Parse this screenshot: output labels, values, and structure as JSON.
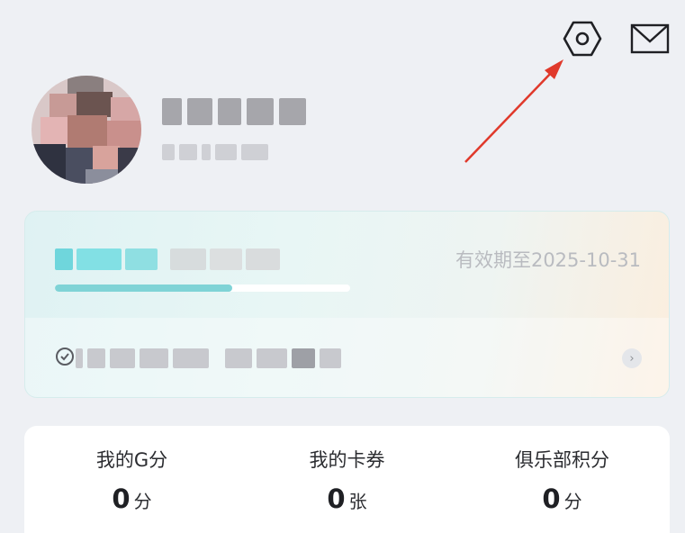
{
  "header": {
    "settings_icon": "settings-hexagon-icon",
    "mail_icon": "mail-icon",
    "annotation_color": "#e0392b"
  },
  "profile": {
    "avatar": "avatar-pixelated",
    "name_redacted": true,
    "id_redacted": true
  },
  "membership": {
    "validity_text": "有效期至2025-10-31",
    "progress_fraction": 0.6,
    "benefit_icon": "coupon-circle-icon",
    "chevron": "›"
  },
  "stats": [
    {
      "label": "我的G分",
      "value": "0",
      "unit": "分"
    },
    {
      "label": "我的卡券",
      "value": "0",
      "unit": "张"
    },
    {
      "label": "俱乐部积分",
      "value": "0",
      "unit": "分"
    }
  ]
}
